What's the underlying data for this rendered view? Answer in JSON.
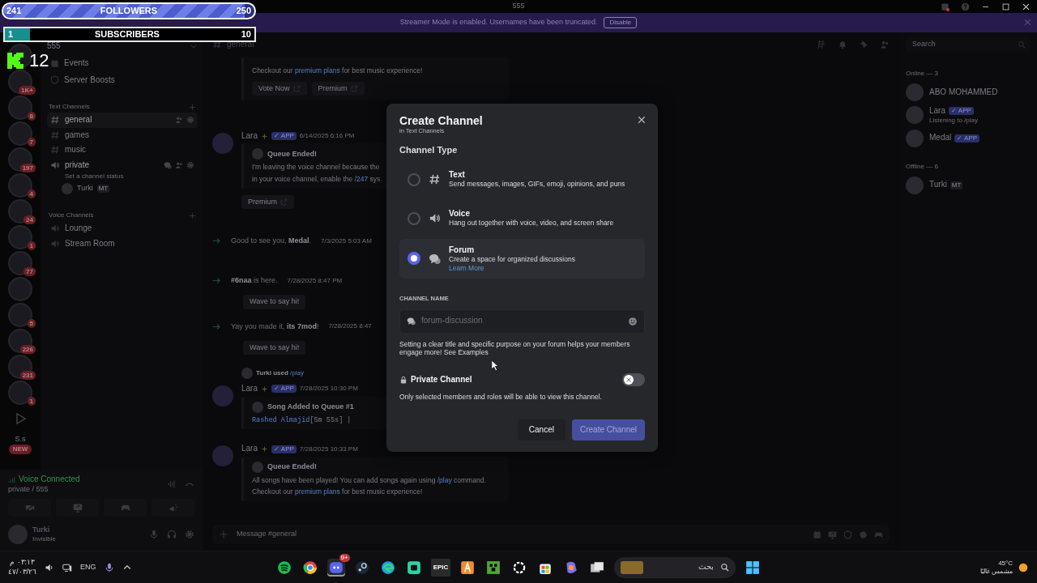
{
  "overlay": {
    "followers": {
      "current": "241",
      "label": "FOLLOWERS",
      "goal": "250",
      "level": 0.96
    },
    "subscribers": {
      "current": "1",
      "label": "SUBSCRIBERS",
      "goal": "10",
      "level": 0.1
    },
    "viewers": "12"
  },
  "title_bar": {
    "title": "555"
  },
  "banner": {
    "text": "Streamer Mode is enabled. Usernames have been truncated.",
    "button": "Disable"
  },
  "servers": [
    {
      "kind": "server"
    },
    {
      "kind": "server",
      "badge": "1K+"
    },
    {
      "kind": "server",
      "badge": "8"
    },
    {
      "kind": "server",
      "badge": "7"
    },
    {
      "kind": "server",
      "badge": "197"
    },
    {
      "kind": "server",
      "badge": "4"
    },
    {
      "kind": "server",
      "badge": "24"
    },
    {
      "kind": "server",
      "badge": "1"
    },
    {
      "kind": "server",
      "badge": "77"
    },
    {
      "kind": "server"
    },
    {
      "kind": "server",
      "badge": "5"
    },
    {
      "kind": "server",
      "badge": "226"
    },
    {
      "kind": "server",
      "badge": "231"
    },
    {
      "kind": "server",
      "badge": "1"
    },
    {
      "kind": "play"
    },
    {
      "kind": "initials",
      "label": "S.s",
      "tag": "NEW"
    }
  ],
  "channel_sidebar": {
    "server_name": "555",
    "links": [
      {
        "kind": "events",
        "label": "Events"
      },
      {
        "kind": "boosts",
        "label": "Server Boosts"
      }
    ],
    "categories": [
      {
        "name": "Text Channels",
        "channels": [
          {
            "kind": "text",
            "name": "general",
            "selected": true
          },
          {
            "kind": "text",
            "name": "games",
            "selected": false
          },
          {
            "kind": "text",
            "name": "music",
            "selected": false
          },
          {
            "kind": "voice",
            "name": "private",
            "selected": false,
            "connected": true,
            "status": "Set a channel status",
            "members": [
              {
                "name": "Turki",
                "tag": "MT"
              }
            ]
          }
        ]
      },
      {
        "name": "Voice Channels",
        "channels": [
          {
            "kind": "voice",
            "name": "Lounge",
            "selected": false,
            "connected": false
          },
          {
            "kind": "voice",
            "name": "Stream Room",
            "selected": false,
            "connected": false
          }
        ]
      }
    ],
    "voice_panel": {
      "status": "Voice Connected",
      "location": "private / 555"
    },
    "user_panel": {
      "name": "Turki",
      "status": "Invisible"
    }
  },
  "chat": {
    "channel": "general",
    "input_placeholder": "Message #general",
    "messages": [
      {
        "kind": "embed_tail",
        "lines": [
          [
            {
              "text": "Checkout our ",
              "kind": "text"
            },
            {
              "text": "premium plans",
              "kind": "link"
            },
            {
              "text": " for best music experience!",
              "kind": "text"
            }
          ]
        ],
        "buttons": [
          "Vote Now",
          "Premium"
        ]
      },
      {
        "kind": "bot",
        "author": "Lara",
        "tag": "✓ APP",
        "time": "6/14/2025 6:16 PM",
        "embed": {
          "title": "Queue Ended!",
          "mono": false,
          "lines": [
            [
              {
                "text": "I'm leaving the voice channel because the",
                "kind": "text"
              }
            ],
            [
              {
                "text": "in your voice channel, enable the ",
                "kind": "text"
              },
              {
                "text": "/247",
                "kind": "link"
              },
              {
                "text": " sys",
                "kind": "text"
              }
            ]
          ]
        },
        "buttons": [
          "Premium"
        ]
      },
      {
        "kind": "join",
        "parts": [
          {
            "text": "Good to see you, ",
            "kind": "text"
          },
          {
            "text": "Medal",
            "kind": "name"
          },
          {
            "text": ".",
            "kind": "text"
          }
        ],
        "time": "7/3/2025 5:03 AM"
      },
      {
        "kind": "join",
        "parts": [
          {
            "text": "#6naa",
            "kind": "name"
          },
          {
            "text": " is here.",
            "kind": "text"
          }
        ],
        "time": "7/28/2025 8:47 PM",
        "wave": "Wave to say hi!"
      },
      {
        "kind": "join",
        "parts": [
          {
            "text": "Yay you made it, ",
            "kind": "text"
          },
          {
            "text": "its 7mod",
            "kind": "name"
          },
          {
            "text": "!",
            "kind": "text"
          }
        ],
        "time": "7/28/2025 8:47",
        "wave": "Wave to say hi!"
      },
      {
        "kind": "bot",
        "reply": [
          {
            "text": "Turki used ",
            "kind": "name"
          },
          {
            "text": "/play",
            "kind": "link"
          }
        ],
        "author": "Lara",
        "tag": "✓ APP",
        "time": "7/28/2025 10:30 PM",
        "embed": {
          "title": "Song Added to Queue #1",
          "mono": true,
          "lines": [
            [
              {
                "text": "Rashed Almajid",
                "kind": "link"
              },
              {
                "text": "[5m 55s] |",
                "kind": "text"
              }
            ]
          ]
        }
      },
      {
        "kind": "bot",
        "author": "Lara",
        "tag": "✓ APP",
        "time": "7/28/2025 10:33 PM",
        "embed": {
          "title": "Queue Ended!",
          "mono": false,
          "lines": [
            [
              {
                "text": "All songs have been played! You can add songs again using ",
                "kind": "text"
              },
              {
                "text": "/play",
                "kind": "link"
              },
              {
                "text": " command.",
                "kind": "text"
              }
            ],
            [
              {
                "text": "Checkout our ",
                "kind": "text"
              },
              {
                "text": "premium plans",
                "kind": "link"
              },
              {
                "text": " for best music experience!",
                "kind": "text"
              }
            ]
          ]
        }
      }
    ]
  },
  "members": {
    "search_placeholder": "Search",
    "groups": [
      {
        "title": "Online — 3",
        "members": [
          {
            "name": "ABO MOHAMMED"
          },
          {
            "name": "Lara",
            "tag": "✓ APP",
            "activity": "Listening to /play"
          },
          {
            "name": "Medal",
            "tag": "✓ APP"
          }
        ]
      },
      {
        "title": "Offline — 6",
        "members": [
          {
            "name": "Turki",
            "tag": "MT"
          }
        ]
      }
    ]
  },
  "modal": {
    "title": "Create Channel",
    "subtitle": "in Text Channels",
    "section_label": "Channel Type",
    "options": [
      {
        "kind": "text",
        "name": "Text",
        "description": "Send messages, images, GIFs, emoji, opinions, and puns",
        "selected": false
      },
      {
        "kind": "voice",
        "name": "Voice",
        "description": "Hang out together with voice, video, and screen share",
        "selected": false
      },
      {
        "kind": "forum",
        "name": "Forum",
        "description": "Create a space for organized discussions",
        "link": "Learn More",
        "selected": true
      }
    ],
    "name_label": "CHANNEL NAME",
    "name_field": {
      "placeholder": "forum-discussion"
    },
    "hint": "Setting a clear title and specific purpose on your forum helps your members engage more!",
    "hint_link": "See Examples",
    "private": {
      "label": "Private Channel",
      "on": false,
      "description": "Only selected members and roles will be able to view this channel."
    },
    "buttons": [
      {
        "kind": "secondary",
        "label": "Cancel",
        "disabled": false
      },
      {
        "kind": "primary",
        "label": "Create Channel",
        "disabled": true
      }
    ]
  },
  "taskbar": {
    "time": "٠٣:١٣ م",
    "date": "٤٧/٠٣/٢٦",
    "language": "ENG",
    "apps": [
      {
        "kind": "music",
        "selected": false
      },
      {
        "kind": "browser",
        "selected": false
      },
      {
        "kind": "chat",
        "selected": true,
        "badge": "9+"
      },
      {
        "kind": "steam",
        "selected": false
      },
      {
        "kind": "edge",
        "selected": false
      },
      {
        "kind": "square",
        "selected": false
      },
      {
        "kind": "epic",
        "selected": false,
        "label": "EPIC"
      },
      {
        "kind": "orange",
        "selected": false
      },
      {
        "kind": "block",
        "selected": false
      },
      {
        "kind": "ring",
        "selected": false
      },
      {
        "kind": "store",
        "selected": false
      },
      {
        "kind": "assistant",
        "selected": false
      },
      {
        "kind": "files",
        "selected": false
      }
    ],
    "search_placeholder": "بحث",
    "weather": {
      "temperature": "45°C",
      "condition": "مشمس غالبًا"
    }
  }
}
